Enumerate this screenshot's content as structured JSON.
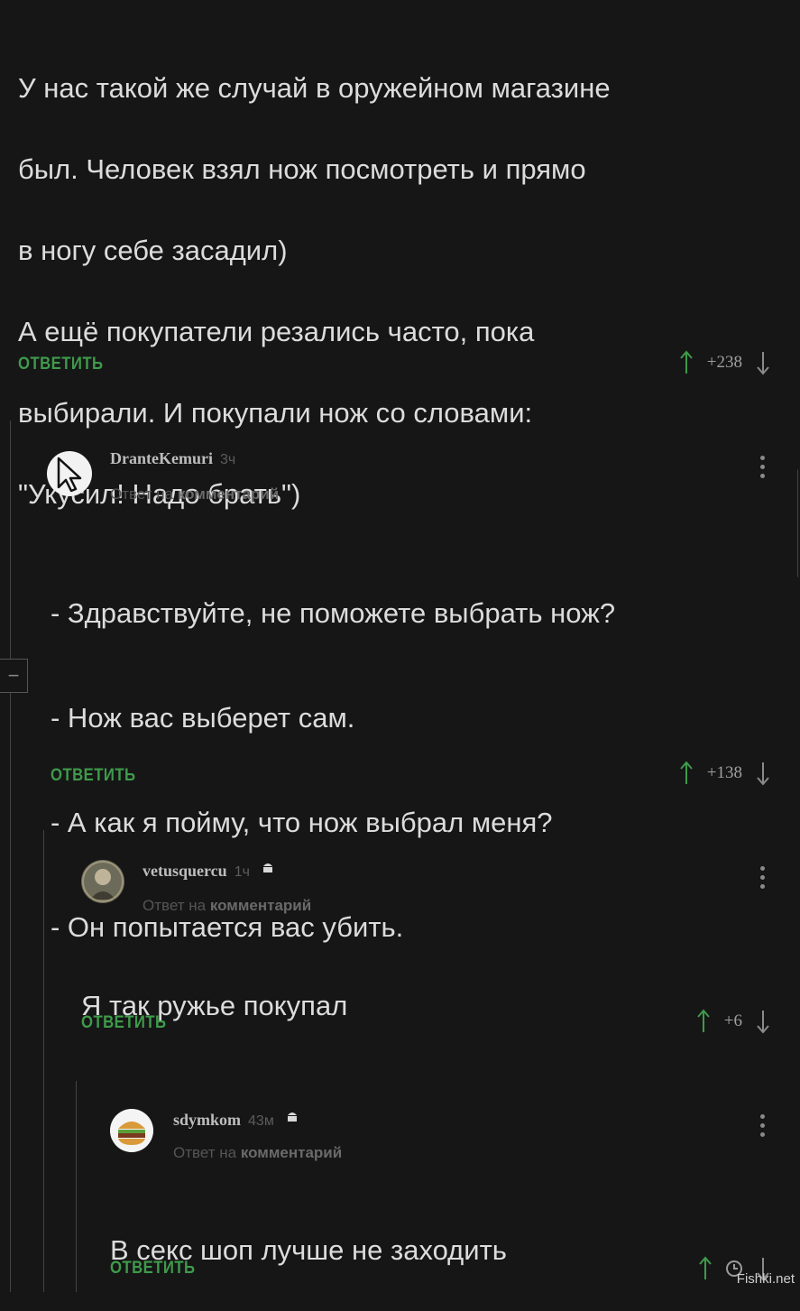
{
  "comments": [
    {
      "lines": [
        "У нас такой же случай в оружейном магазине",
        "был. Человек взял нож посмотреть и прямо",
        "в ногу себе засадил)",
        "А ещё покупатели резались часто, пока",
        "выбирали. И покупали нож со словами:",
        "\"Укусил! Надо брать\")"
      ],
      "reply_label": "ОТВЕТИТЬ",
      "score": "+238"
    },
    {
      "author": "DranteKemuri",
      "time": "3ч",
      "sub_prefix": "Ответ на",
      "sub_link": "комментарий",
      "lines": [
        "- Здравствуйте, не поможете выбрать нож?",
        "- Нож вас выберет сам.",
        "- А как я пойму, что нож выбрал меня?",
        "- Он попытается вас убить."
      ],
      "reply_label": "ОТВЕТИТЬ",
      "score": "+138"
    },
    {
      "author": "vetusquercu",
      "time": "1ч",
      "sub_prefix": "Ответ на",
      "sub_link": "комментарий",
      "lines": [
        "Я так ружье покупал"
      ],
      "reply_label": "ОТВЕТИТЬ",
      "score": "+6"
    },
    {
      "author": "sdymkom",
      "time": "43м",
      "sub_prefix": "Ответ на",
      "sub_link": "комментарий",
      "lines": [
        "В секс шоп лучше не заходить"
      ],
      "reply_label": "ОТВЕТИТЬ",
      "score": ""
    }
  ],
  "collapse_label": "−",
  "watermark": "Fishki.net",
  "colors": {
    "accent": "#3e9b4a",
    "background": "#161617"
  }
}
